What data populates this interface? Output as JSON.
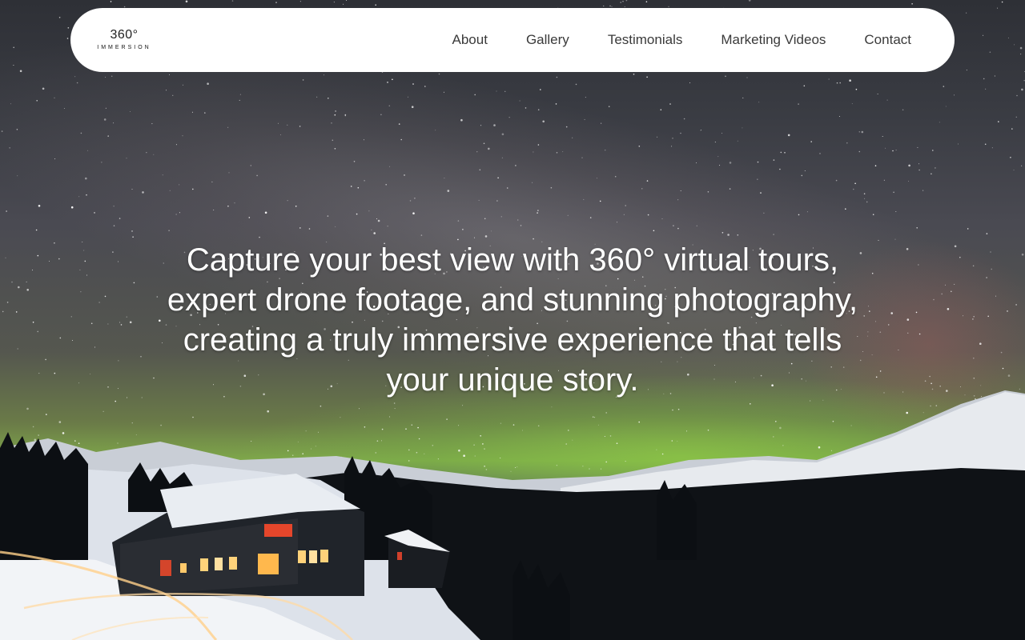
{
  "brand": {
    "logo_main": "360°",
    "logo_sub": "IMMERSION"
  },
  "nav": {
    "items": [
      {
        "label": "About"
      },
      {
        "label": "Gallery"
      },
      {
        "label": "Testimonials"
      },
      {
        "label": "Marketing Videos"
      },
      {
        "label": "Contact"
      }
    ]
  },
  "hero": {
    "headline_lines": [
      "Capture your best view with 360° virtual tours,",
      "expert drone footage, and stunning photography,",
      "creating a truly immersive experience that tells",
      "your unique story."
    ]
  },
  "colors": {
    "navbar_bg": "#ffffff",
    "nav_text": "#3a3a3a",
    "headline_text": "#ffffff",
    "aurora": "#7fa84a"
  }
}
